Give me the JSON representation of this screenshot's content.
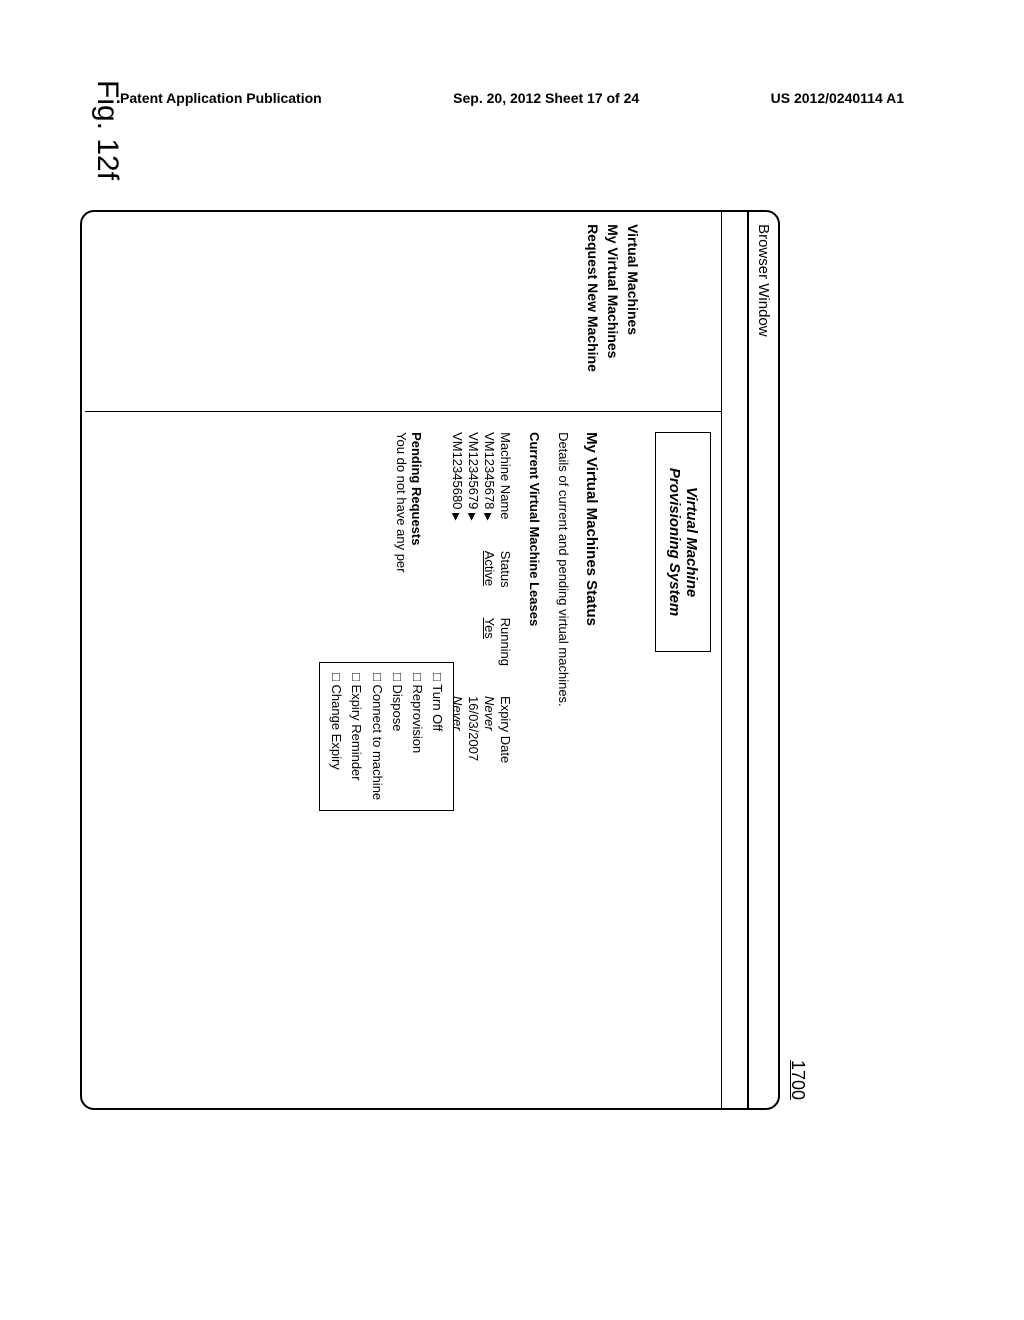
{
  "page_header": {
    "left": "Patent Application Publication",
    "center": "Sep. 20, 2012  Sheet 17 of 24",
    "right": "US 2012/0240114 A1"
  },
  "figure": {
    "label": "Fig. 12f",
    "ref": "1700"
  },
  "browser": {
    "title": "Browser Window"
  },
  "brand": {
    "line1": "Virtual Machine",
    "line2": "Provisioning System"
  },
  "sidebar": {
    "heading": "Virtual Machines",
    "items": [
      "My Virtual Machines",
      "Request New Machine"
    ]
  },
  "main": {
    "title": "My Virtual Machines Status",
    "desc": "Details of current and pending virtual machines.",
    "leases_title": "Current Virtual Machine Leases",
    "table": {
      "headers": [
        "Machine Name",
        "Status",
        "Running",
        "Expiry Date"
      ],
      "rows": [
        {
          "name": "VM12345678",
          "status": "Active",
          "running": "Yes",
          "expiry": "Never",
          "islink": true,
          "expItalic": true
        },
        {
          "name": "VM12345679",
          "status": "",
          "running": "",
          "expiry": "16/03/2007",
          "islink": false,
          "expItalic": false
        },
        {
          "name": "VM12345680",
          "status": "",
          "running": "",
          "expiry": "Never",
          "islink": false,
          "expItalic": true
        }
      ]
    },
    "pending": {
      "title": "Pending Requests",
      "text": "You do not have any per"
    },
    "menu": [
      "Turn Off",
      "Reprovision",
      "Dispose",
      "Connect to machine",
      "Expiry Reminder",
      "Change Expiry"
    ]
  }
}
